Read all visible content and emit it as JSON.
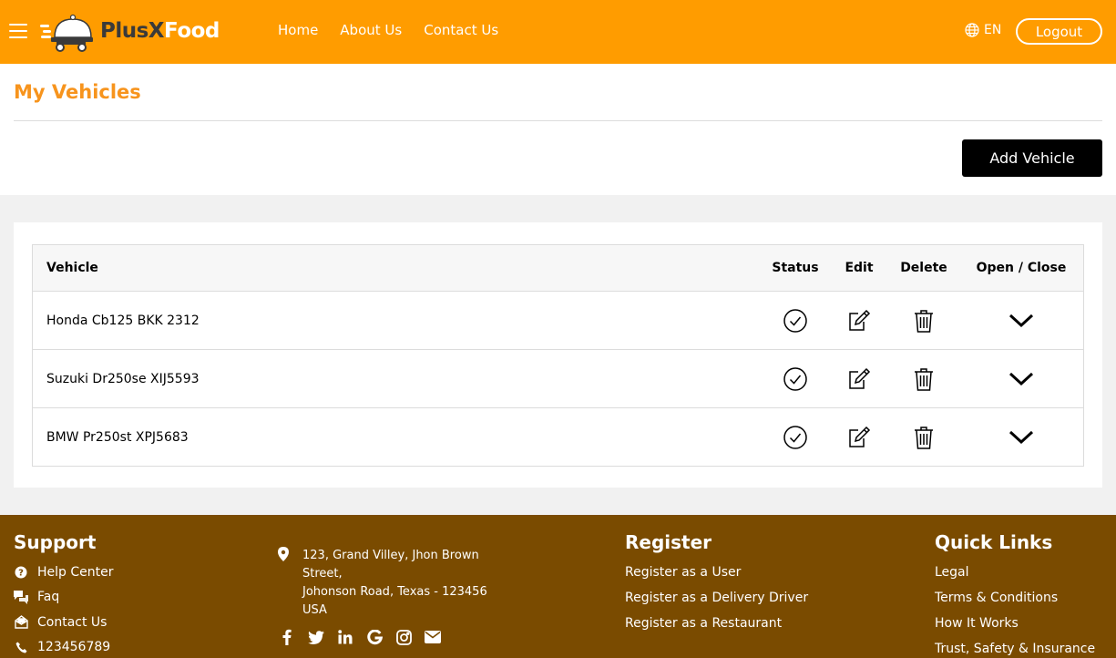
{
  "header": {
    "brand_part1": "PlusX",
    "brand_part2": "Food",
    "nav": [
      "Home",
      "About Us",
      "Contact Us"
    ],
    "language": "EN",
    "logout_label": "Logout",
    "accent_color": "#ff9c00"
  },
  "page": {
    "title": "My Vehicles",
    "add_button_label": "Add Vehicle"
  },
  "table": {
    "columns": [
      "Vehicle",
      "Status",
      "Edit",
      "Delete",
      "Open / Close"
    ],
    "rows": [
      {
        "vehicle": "Honda Cb125 BKK 2312",
        "status_icon": "check-circle-icon",
        "edit_icon": "edit-icon",
        "delete_icon": "trash-icon",
        "open_icon": "chevron-down-icon"
      },
      {
        "vehicle": "Suzuki Dr250se XIJ5593",
        "status_icon": "check-circle-icon",
        "edit_icon": "edit-icon",
        "delete_icon": "trash-icon",
        "open_icon": "chevron-down-icon"
      },
      {
        "vehicle": "BMW Pr250st XPJ5683",
        "status_icon": "check-circle-icon",
        "edit_icon": "edit-icon",
        "delete_icon": "trash-icon",
        "open_icon": "chevron-down-icon"
      }
    ]
  },
  "footer": {
    "support": {
      "heading": "Support",
      "items": [
        {
          "label": "Help Center",
          "icon": "question-circle-icon"
        },
        {
          "label": "Faq",
          "icon": "faq-icon"
        },
        {
          "label": "Contact Us",
          "icon": "envelope-open-icon"
        },
        {
          "label": "123456789",
          "icon": "phone-icon"
        }
      ]
    },
    "address": {
      "lines": [
        "123, Grand Villey, Jhon Brown",
        "Street,",
        "Johonson Road, Texas - 123456",
        "USA"
      ],
      "icon": "map-marker-icon"
    },
    "socials": [
      "facebook-icon",
      "twitter-icon",
      "linkedin-icon",
      "google-icon",
      "instagram-icon",
      "envelope-icon"
    ],
    "register": {
      "heading": "Register",
      "items": [
        "Register as a User",
        "Register as a Delivery Driver",
        "Register as a Restaurant"
      ]
    },
    "quick_links": {
      "heading": "Quick Links",
      "items": [
        "Legal",
        "Terms & Conditions",
        "How It Works",
        "Trust, Safety & Insurance"
      ]
    },
    "background_color": "#7a4b00"
  }
}
